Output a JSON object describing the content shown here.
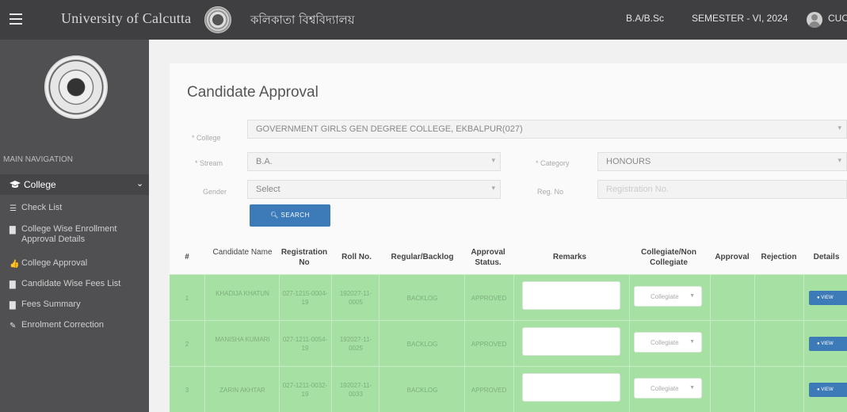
{
  "topbar": {
    "title": "University of Calcutta",
    "title_bengali": "কলিকাতা বিশ্ববিদ্যালয়",
    "course": "B.A/B.Sc",
    "semester": "SEMESTER - VI, 2024",
    "user": "CUO"
  },
  "sidebar": {
    "main_nav_label": "MAIN NAVIGATION",
    "section_label": "College",
    "items": [
      {
        "label": "Check List",
        "icon": "list-icon"
      },
      {
        "label": "College Wise Enrollment Approval Details",
        "icon": "file-icon"
      },
      {
        "label": "College Approval",
        "icon": "thumbs-up-icon"
      },
      {
        "label": "Candidate Wise Fees List",
        "icon": "file-icon"
      },
      {
        "label": "Fees Summary",
        "icon": "file-icon"
      },
      {
        "label": "Enrolment Correction",
        "icon": "edit-icon"
      }
    ]
  },
  "page": {
    "title": "Candidate Approval",
    "filters": {
      "college_label": "* College",
      "college_value": "GOVERNMENT GIRLS GEN DEGREE COLLEGE, EKBALPUR(027)",
      "stream_label": "* Stream",
      "stream_value": "B.A.",
      "category_label": "* Category",
      "category_value": "HONOURS",
      "gender_label": "Gender",
      "gender_value": "Select",
      "regno_label": "Reg. No",
      "regno_placeholder": "Registration No."
    },
    "search_label": "SEARCH"
  },
  "table": {
    "headers": {
      "index": "#",
      "name": "Candidate Name",
      "regno": "Registration No",
      "roll": "Roll No.",
      "type": "Regular/Backlog",
      "status": "Approval Status.",
      "remarks": "Remarks",
      "collegiate": "Collegiate/Non Collegiate",
      "approval": "Approval",
      "rejection": "Rejection",
      "details": "Details"
    },
    "rows": [
      {
        "index": "1",
        "name": "KHADIJA KHATUN",
        "regno": "027-1215-0004-19",
        "roll": "192027-11-0005",
        "type": "BACKLOG",
        "status": "APPROVED",
        "collegiate": "Collegiate",
        "view": "VIEW"
      },
      {
        "index": "2",
        "name": "MANISHA KUMARI",
        "regno": "027-1211-0054-19",
        "roll": "192027-11-0025",
        "type": "BACKLOG",
        "status": "APPROVED",
        "collegiate": "Collegiate",
        "view": "VIEW"
      },
      {
        "index": "3",
        "name": "ZARIN AKHTAR",
        "regno": "027-1211-0032-19",
        "roll": "192027-11-0033",
        "type": "BACKLOG",
        "status": "APPROVED",
        "collegiate": "Collegiate",
        "view": "VIEW"
      }
    ]
  },
  "colors": {
    "topbar": "#3f3f42",
    "sidebar": "#505052",
    "row_green": "#a6e0a3",
    "button_blue": "#3d7ab8"
  }
}
